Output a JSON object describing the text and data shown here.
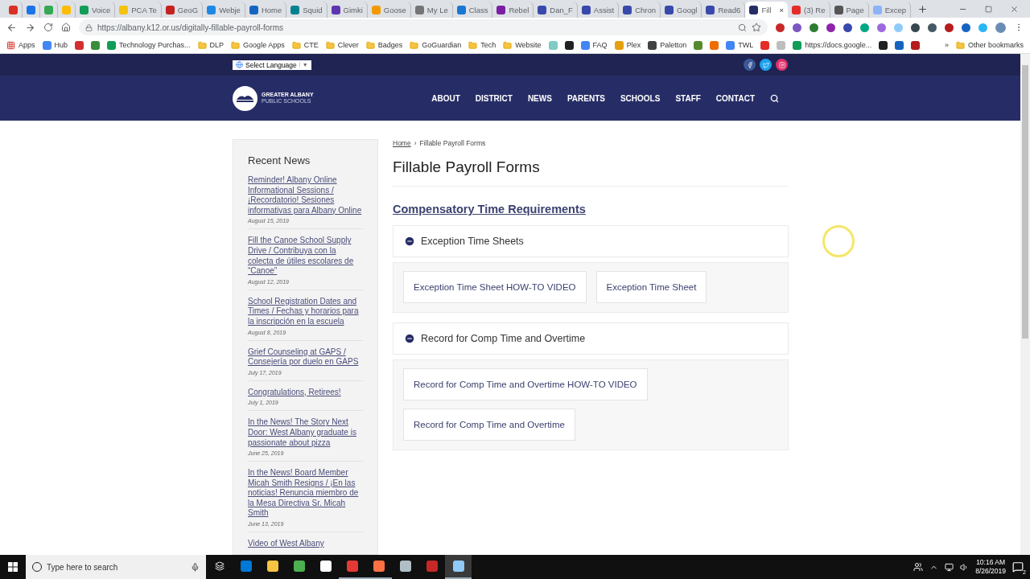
{
  "tabs": [
    {
      "color": "#d93025",
      "selected": false
    },
    {
      "color": "#1a73e8",
      "selected": false
    },
    {
      "color": "#34a853",
      "selected": false
    },
    {
      "color": "#fbbc04",
      "selected": false
    },
    {
      "title": "Voice",
      "color": "#0f9d58",
      "selected": false
    },
    {
      "title": "PCA Te",
      "color": "#f4c20d",
      "selected": false
    },
    {
      "title": "GeoG",
      "color": "#c5221f",
      "selected": false
    },
    {
      "title": "Webje",
      "color": "#1e88e5",
      "selected": false
    },
    {
      "title": "Home",
      "color": "#1565c0",
      "selected": false
    },
    {
      "title": "Squid",
      "color": "#00838f",
      "selected": false
    },
    {
      "title": "Gimki",
      "color": "#5e35b1",
      "selected": false
    },
    {
      "title": "Goose",
      "color": "#f29900",
      "selected": false
    },
    {
      "title": "My Le",
      "color": "#757575",
      "selected": false
    },
    {
      "title": "Class",
      "color": "#1976d2",
      "selected": false
    },
    {
      "title": "Rebel",
      "color": "#7b1fa2",
      "selected": false
    },
    {
      "title": "Dan_F",
      "color": "#3949ab",
      "selected": false
    },
    {
      "title": "Assist",
      "color": "#3949ab",
      "selected": false
    },
    {
      "title": "Chron",
      "color": "#3949ab",
      "selected": false
    },
    {
      "title": "Googl",
      "color": "#3949ab",
      "selected": false
    },
    {
      "title": "Read6",
      "color": "#3949ab",
      "selected": false
    },
    {
      "title": "Fill",
      "color": "#262d66",
      "selected": true,
      "close": "×"
    },
    {
      "title": "(3) Re",
      "color": "#e52d27",
      "selected": false
    },
    {
      "title": "Page",
      "color": "#555555",
      "selected": false
    },
    {
      "title": "Excep",
      "color": "#8ab4f8",
      "selected": false
    }
  ],
  "url": "https://albany.k12.or.us/digitally-fillable-payroll-forms",
  "extensions": [
    {
      "color": "#c62828"
    },
    {
      "color": "#7e57c2"
    },
    {
      "color": "#2e7d32"
    },
    {
      "color": "#8e24aa"
    },
    {
      "color": "#3949ab"
    },
    {
      "color": "#00a884"
    },
    {
      "color": "#9c6ade"
    },
    {
      "color": "#90caf9"
    },
    {
      "color": "#37474f"
    },
    {
      "color": "#455a64"
    },
    {
      "color": "#b71c1c"
    },
    {
      "color": "#1565c0"
    },
    {
      "color": "#29b6f6"
    }
  ],
  "bookmarks": [
    {
      "kind": "apps",
      "label": "Apps"
    },
    {
      "kind": "site",
      "label": "Hub",
      "color": "#4285f4"
    },
    {
      "kind": "site",
      "color": "#d32f2f"
    },
    {
      "kind": "site",
      "color": "#388e3c"
    },
    {
      "kind": "site",
      "label": "Technology Purchas...",
      "color": "#0f9d58"
    },
    {
      "kind": "folder",
      "label": "DLP"
    },
    {
      "kind": "folder",
      "label": "Google Apps"
    },
    {
      "kind": "folder",
      "label": "CTE"
    },
    {
      "kind": "folder",
      "label": "Clever"
    },
    {
      "kind": "folder",
      "label": "Badges"
    },
    {
      "kind": "folder",
      "label": "GoGuardian"
    },
    {
      "kind": "folder",
      "label": "Tech"
    },
    {
      "kind": "folder",
      "label": "Website"
    },
    {
      "kind": "site",
      "color": "#80cbc4"
    },
    {
      "kind": "site",
      "color": "#212121"
    },
    {
      "kind": "site",
      "label": "FAQ",
      "color": "#4285f4"
    },
    {
      "kind": "site",
      "label": "Plex",
      "color": "#e5a00d"
    },
    {
      "kind": "site",
      "label": "Paletton",
      "color": "#424242"
    },
    {
      "kind": "site",
      "color": "#558b2f"
    },
    {
      "kind": "site",
      "color": "#ef6c00"
    },
    {
      "kind": "site",
      "label": "TWL",
      "color": "#4285f4"
    },
    {
      "kind": "site",
      "color": "#e52d27"
    },
    {
      "kind": "site",
      "color": "#bdbdbd"
    },
    {
      "kind": "site",
      "label": "https://docs.google...",
      "color": "#0f9d58"
    },
    {
      "kind": "site",
      "color": "#212121"
    },
    {
      "kind": "site",
      "color": "#1565c0"
    },
    {
      "kind": "site",
      "color": "#b71c1c"
    }
  ],
  "bookmarks_more": "»",
  "other_bookmarks": "Other bookmarks",
  "site": {
    "language": "Select Language",
    "language_caret": "▼",
    "logo_line1": "GREATER ALBANY",
    "logo_line2": "PUBLIC SCHOOLS",
    "nav": [
      "ABOUT",
      "DISTRICT",
      "NEWS",
      "PARENTS",
      "SCHOOLS",
      "STAFF",
      "CONTACT"
    ]
  },
  "sidebar": {
    "title": "Recent News",
    "items": [
      {
        "title": "Reminder! Albany Online Informational Sessions / ¡Recordatorio! Sesiones informativas para Albany Online",
        "date": "August 15, 2019"
      },
      {
        "title": "Fill the Canoe School Supply Drive / Contribuya con la colecta de útiles escolares de “Canoe”",
        "date": "August 12, 2019"
      },
      {
        "title": "School Registration Dates and Times / Fechas y horarios para la inscripción en la escuela",
        "date": "August 8, 2019"
      },
      {
        "title": "Grief Counseling at GAPS / Consejería por duelo en GAPS",
        "date": "July 17, 2019"
      },
      {
        "title": "Congratulations, Retirees!",
        "date": "July 1, 2019"
      },
      {
        "title": "In the News! The Story Next Door: West Albany graduate is passionate about pizza",
        "date": "June 25, 2019"
      },
      {
        "title": "In the News! Board Member Micah Smith Resigns / ¡En las noticias! Renuncia miembro de la Mesa Directiva Sr. Micah Smith",
        "date": "June 13, 2019"
      },
      {
        "title": "Video of West Albany"
      }
    ]
  },
  "breadcrumb": {
    "home": "Home",
    "separator": "›",
    "current": "Fillable Payroll Forms"
  },
  "page_title": "Fillable Payroll Forms",
  "section_link": "Compensatory Time Requirements",
  "accordions": [
    {
      "title": "Exception Time Sheets",
      "expanded": true,
      "buttons": [
        "Exception Time Sheet HOW-TO VIDEO",
        "Exception Time Sheet"
      ]
    },
    {
      "title": "Record for Comp Time and Overtime",
      "expanded": true,
      "buttons": [
        "Record for Comp Time and Overtime HOW-TO VIDEO",
        "Record for Comp Time and Overtime"
      ]
    }
  ],
  "taskbar": {
    "search_placeholder": "Type here to search",
    "apps": [
      {
        "color": "#0078d7",
        "running": false,
        "selected": false
      },
      {
        "color": "#f6c343",
        "running": false,
        "selected": false
      },
      {
        "color": "#4caf50",
        "running": false,
        "selected": false
      },
      {
        "color": "#ffffff",
        "running": false,
        "selected": false
      },
      {
        "color": "#e53935",
        "running": true,
        "selected": false
      },
      {
        "color": "#ff7043",
        "running": true,
        "selected": false
      },
      {
        "color": "#b0bec5",
        "running": false,
        "selected": false
      },
      {
        "color": "#c62828",
        "running": false,
        "selected": false
      },
      {
        "color": "#90caf9",
        "running": true,
        "selected": true
      }
    ],
    "time": "10:16 AM",
    "date": "8/26/2019",
    "notifications": "2"
  }
}
